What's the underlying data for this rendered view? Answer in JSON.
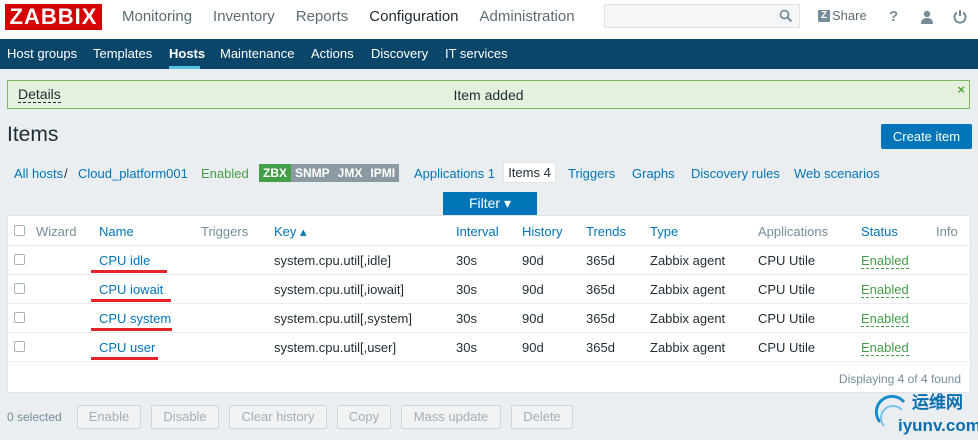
{
  "header": {
    "logo": "ZABBIX",
    "menu": [
      "Monitoring",
      "Inventory",
      "Reports",
      "Configuration",
      "Administration"
    ],
    "active_menu": "Configuration",
    "search_placeholder": "",
    "share_badge": "Z",
    "share_label": "Share",
    "help_label": "?"
  },
  "subnav": [
    "Host groups",
    "Templates",
    "Hosts",
    "Maintenance",
    "Actions",
    "Discovery",
    "IT services"
  ],
  "message": {
    "details": "Details",
    "text": "Item added",
    "close": "×"
  },
  "page": {
    "title": "Items",
    "create_button": "Create item"
  },
  "hostnav": {
    "all_hosts": "All hosts",
    "sep": "/",
    "host": "Cloud_platform001",
    "enabled": "Enabled",
    "badges": [
      "ZBX",
      "SNMP",
      "JMX",
      "IPMI"
    ],
    "applications": "Applications 1",
    "items": "Items 4",
    "triggers": "Triggers",
    "graphs": "Graphs",
    "discovery": "Discovery rules",
    "web": "Web scenarios"
  },
  "filter_label": "Filter ▾",
  "table": {
    "headers": {
      "wizard": "Wizard",
      "name": "Name",
      "triggers": "Triggers",
      "key": "Key ▴",
      "interval": "Interval",
      "history": "History",
      "trends": "Trends",
      "type": "Type",
      "applications": "Applications",
      "status": "Status",
      "info": "Info"
    },
    "rows": [
      {
        "name": "CPU idle",
        "key": "system.cpu.util[,idle]",
        "interval": "30s",
        "history": "90d",
        "trends": "365d",
        "type": "Zabbix agent",
        "applications": "CPU Utile",
        "status": "Enabled"
      },
      {
        "name": "CPU iowait",
        "key": "system.cpu.util[,iowait]",
        "interval": "30s",
        "history": "90d",
        "trends": "365d",
        "type": "Zabbix agent",
        "applications": "CPU Utile",
        "status": "Enabled"
      },
      {
        "name": "CPU system",
        "key": "system.cpu.util[,system]",
        "interval": "30s",
        "history": "90d",
        "trends": "365d",
        "type": "Zabbix agent",
        "applications": "CPU Utile",
        "status": "Enabled"
      },
      {
        "name": "CPU user",
        "key": "system.cpu.util[,user]",
        "interval": "30s",
        "history": "90d",
        "trends": "365d",
        "type": "Zabbix agent",
        "applications": "CPU Utile",
        "status": "Enabled"
      }
    ],
    "footer": "Displaying 4 of 4 found"
  },
  "actions": {
    "selected": "0 selected",
    "buttons": [
      "Enable",
      "Disable",
      "Clear history",
      "Copy",
      "Mass update",
      "Delete"
    ]
  },
  "watermark": {
    "top": "运维网",
    "bottom": "iyunv.com"
  },
  "colors": {
    "brand_red": "#d40000",
    "nav_blue": "#0a466a",
    "link_blue": "#0275b8",
    "enabled_green": "#429e47",
    "annotation_red": "#e8242b"
  }
}
